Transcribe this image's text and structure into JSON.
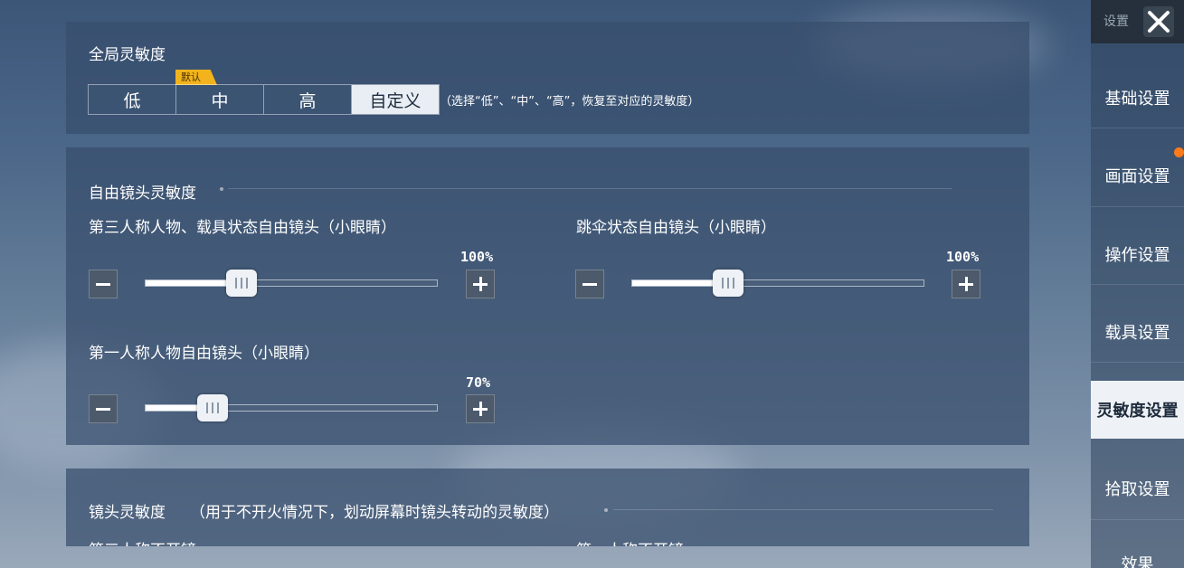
{
  "global": {
    "title": "全局灵敏度",
    "default_tag": "默认",
    "options": [
      "低",
      "中",
      "高",
      "自定义"
    ],
    "selected": "自定义",
    "hint": "（选择“低”、“中”、“高”，恢复至对应的灵敏度）"
  },
  "free_camera": {
    "title": "自由镜头灵敏度",
    "sliders": [
      {
        "label": "第三人称人物、载具状态自由镜头（小眼睛）",
        "value_text": "100%",
        "value": 0.33
      },
      {
        "label": "跳伞状态自由镜头（小眼睛）",
        "value_text": "100%",
        "value": 0.33
      },
      {
        "label": "第一人称人物自由镜头（小眼睛）",
        "value_text": "70%",
        "value": 0.23
      }
    ]
  },
  "camera": {
    "title": "镜头灵敏度",
    "note": "（用于不开火情况下，划动屏幕时镜头转动的灵敏度）",
    "sub_left": "第三人称不开镜",
    "sub_right": "第一人称不开镜"
  },
  "sidebar": {
    "header": "设置",
    "items": [
      "基础设置",
      "画面设置",
      "操作设置",
      "载具设置",
      "灵敏度设置",
      "拾取设置",
      "效果"
    ],
    "active": "灵敏度设置"
  },
  "colors": {
    "accent_tag": "#f2b31c",
    "notification_dot": "#ff7a1a"
  }
}
